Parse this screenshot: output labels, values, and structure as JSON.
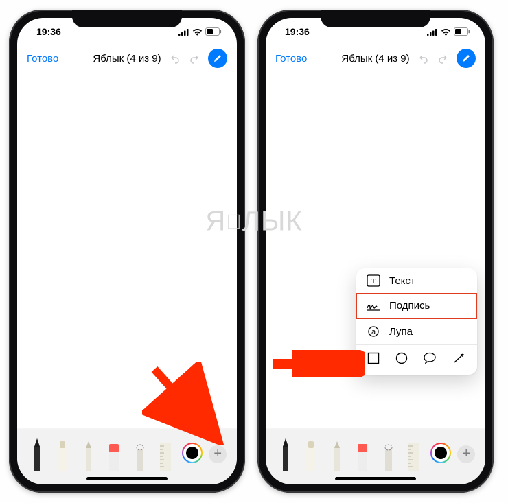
{
  "status": {
    "time": "19:36"
  },
  "nav": {
    "done": "Готово",
    "title": "Яблык (4 из 9)"
  },
  "menu": {
    "text": "Текст",
    "signature": "Подпись",
    "magnifier": "Лупа"
  },
  "watermark": {
    "left": "Я",
    "right": "ЛЫК"
  }
}
